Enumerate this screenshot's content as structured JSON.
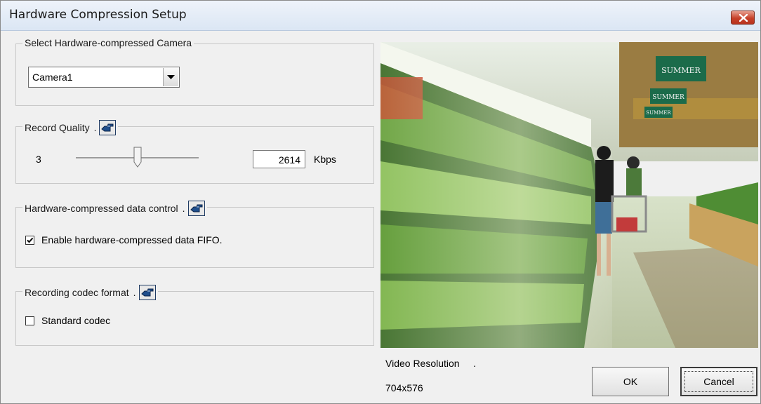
{
  "window": {
    "title": "Hardware Compression Setup"
  },
  "camera_group": {
    "title": "Select Hardware-compressed Camera",
    "selected": "Camera1"
  },
  "quality_group": {
    "title": "Record Quality",
    "suffix": ".",
    "slider_value": "3",
    "slider_level_fraction": 0.5,
    "bitrate": "2614",
    "unit": "Kbps"
  },
  "data_control_group": {
    "title": "Hardware-compressed data control",
    "suffix": ".",
    "fifo_label": "Enable hardware-compressed data FIFO.",
    "fifo_checked": true
  },
  "codec_group": {
    "title": "Recording codec format",
    "suffix": ".",
    "standard_label": "Standard codec",
    "standard_checked": false
  },
  "preview": {
    "store_sign": "SUMMER"
  },
  "resolution": {
    "label": "Video Resolution",
    "suffix": ".",
    "value": "704x576"
  },
  "buttons": {
    "ok": "OK",
    "cancel": "Cancel"
  },
  "colors": {
    "close_red": "#c7412a",
    "icon_blue": "#1f4e8c",
    "sign_green": "#1b6b4a"
  }
}
